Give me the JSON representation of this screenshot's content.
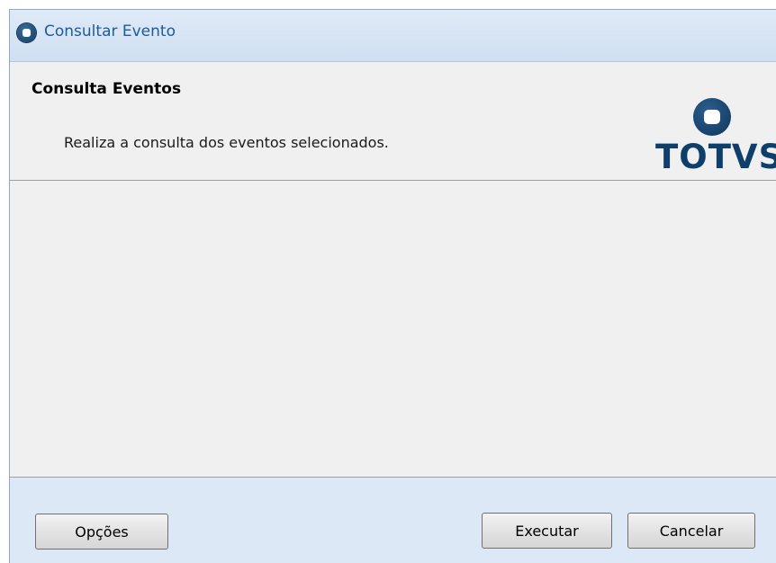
{
  "window": {
    "title": "Consultar Evento"
  },
  "header": {
    "title": "Consulta Eventos",
    "description": "Realiza a consulta dos eventos selecionados.",
    "logo_text": "TOTVS"
  },
  "footer": {
    "options_label": "Opções",
    "execute_label": "Executar",
    "cancel_label": "Cancelar"
  },
  "colors": {
    "title_text": "#1f5a9a",
    "logo": "#0e3f6b",
    "frame": "#dce8f5",
    "panel": "#f0f0f0"
  }
}
